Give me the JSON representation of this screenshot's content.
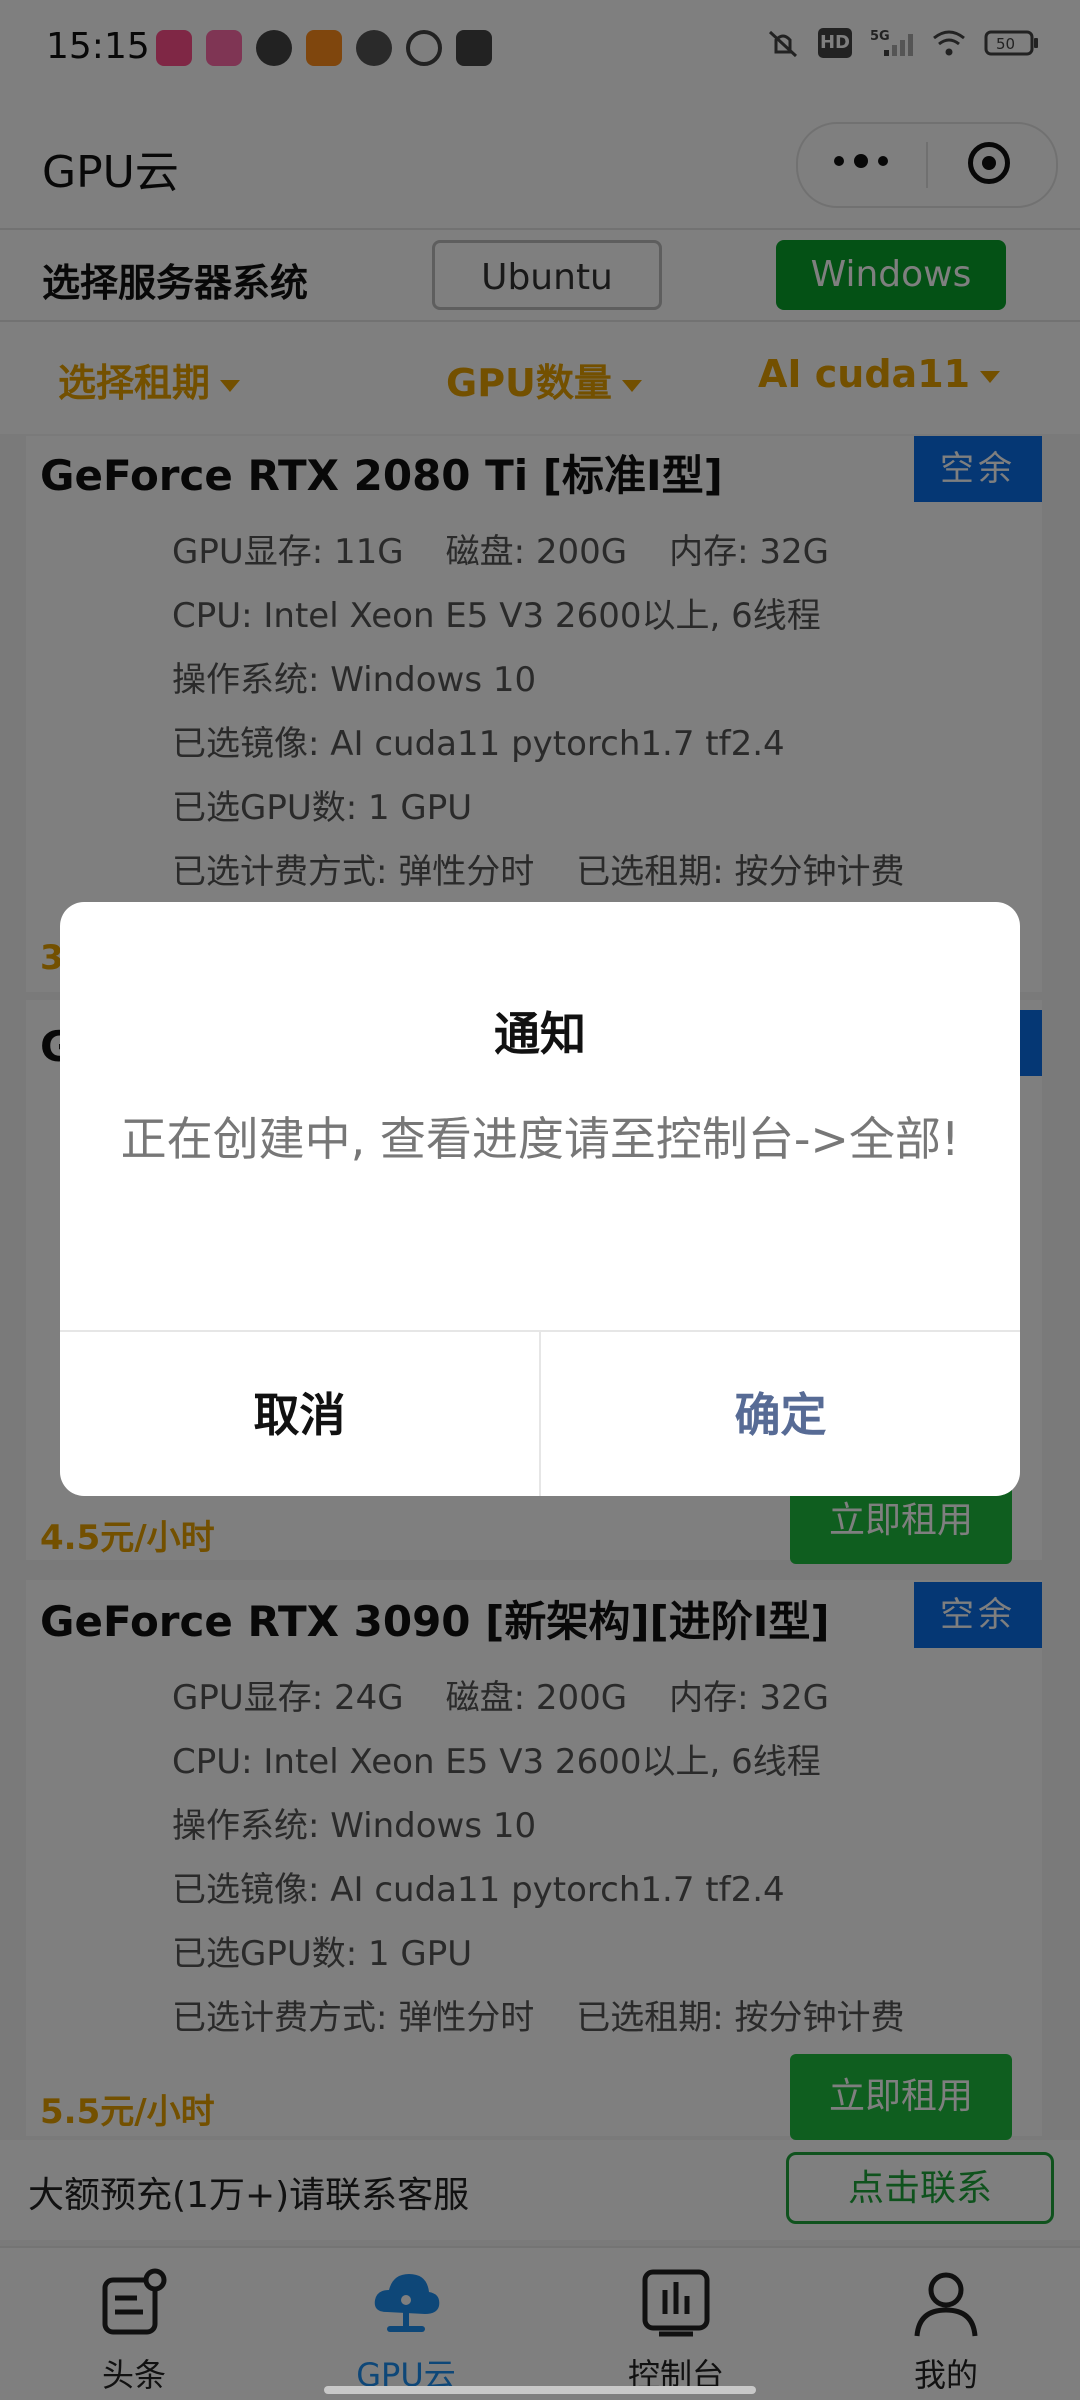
{
  "status_bar": {
    "time": "15:15",
    "network": "5G",
    "battery": "50"
  },
  "nav": {
    "title": "GPU云"
  },
  "os_select": {
    "label": "选择服务器系统",
    "options": [
      "Ubuntu",
      "Windows"
    ],
    "selected": "Windows"
  },
  "filters": {
    "period": "选择租期",
    "gpu_count": "GPU数量",
    "image": "AI cuda11"
  },
  "cards": [
    {
      "title": "GeForce RTX 2080 Ti [标准I型]",
      "badge": "空余",
      "gpu_mem": "GPU显存: 11G",
      "disk": "磁盘: 200G",
      "ram": "内存: 32G",
      "cpu": "CPU: Intel Xeon E5 V3 2600以上, 6线程",
      "os": "操作系统: Windows 10",
      "image": "已选镜像: AI cuda11 pytorch1.7 tf2.4",
      "gpus": "已选GPU数: 1 GPU",
      "billing": "已选计费方式: 弹性分时",
      "period": "已选租期: 按分钟计费",
      "price_partial": "3"
    },
    {
      "title_partial": "G",
      "price": "4.5元/小时",
      "rent": "立即租用"
    },
    {
      "title": "GeForce RTX 3090 [新架构][进阶I型]",
      "badge": "空余",
      "gpu_mem": "GPU显存: 24G",
      "disk": "磁盘: 200G",
      "ram": "内存: 32G",
      "cpu": "CPU: Intel Xeon E5 V3 2600以上, 6线程",
      "os": "操作系统: Windows 10",
      "image": "已选镜像: AI cuda11 pytorch1.7 tf2.4",
      "gpus": "已选GPU数: 1 GPU",
      "billing": "已选计费方式: 弹性分时",
      "period": "已选租期: 按分钟计费",
      "price": "5.5元/小时",
      "rent": "立即租用"
    }
  ],
  "promo": {
    "text": "大额预充(1万+)请联系客服",
    "button": "点击联系"
  },
  "tabbar": {
    "items": [
      {
        "label": "头条",
        "icon": "news-icon"
      },
      {
        "label": "GPU云",
        "icon": "cloud-icon"
      },
      {
        "label": "控制台",
        "icon": "dashboard-icon"
      },
      {
        "label": "我的",
        "icon": "user-icon"
      }
    ],
    "active": "GPU云",
    "active_color": "#1c8ef0"
  },
  "dialog": {
    "title": "通知",
    "content": "正在创建中, 查看进度请至控制台->全部!",
    "cancel": "取消",
    "confirm": "确定"
  }
}
